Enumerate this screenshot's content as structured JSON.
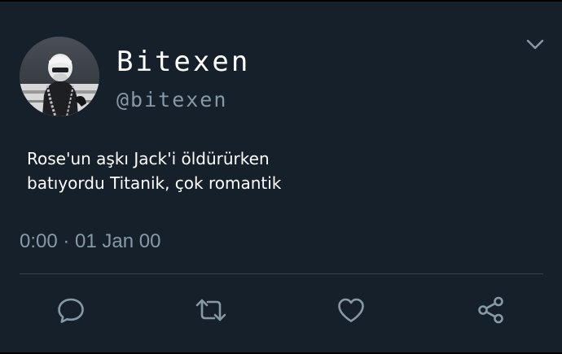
{
  "tweet": {
    "author": {
      "display_name": "Bitexen",
      "handle": "@bitexen",
      "avatar_icon": "masked-figure-avatar"
    },
    "text_lines": [
      "Rose'un aşkı Jack'i öldürürken",
      "batıyordu Titanik, çok romantik"
    ],
    "timestamp": "0:00 · 01 Jan 00",
    "menu_icon": "chevron-down-icon",
    "actions": [
      {
        "name": "reply",
        "icon": "comment-icon"
      },
      {
        "name": "retweet",
        "icon": "retweet-icon"
      },
      {
        "name": "like",
        "icon": "heart-icon"
      },
      {
        "name": "share",
        "icon": "share-icon"
      }
    ]
  },
  "colors": {
    "background": "#15202b",
    "primary_text": "#ffffff",
    "secondary_text": "#8899a6",
    "divider": "#38444d"
  }
}
